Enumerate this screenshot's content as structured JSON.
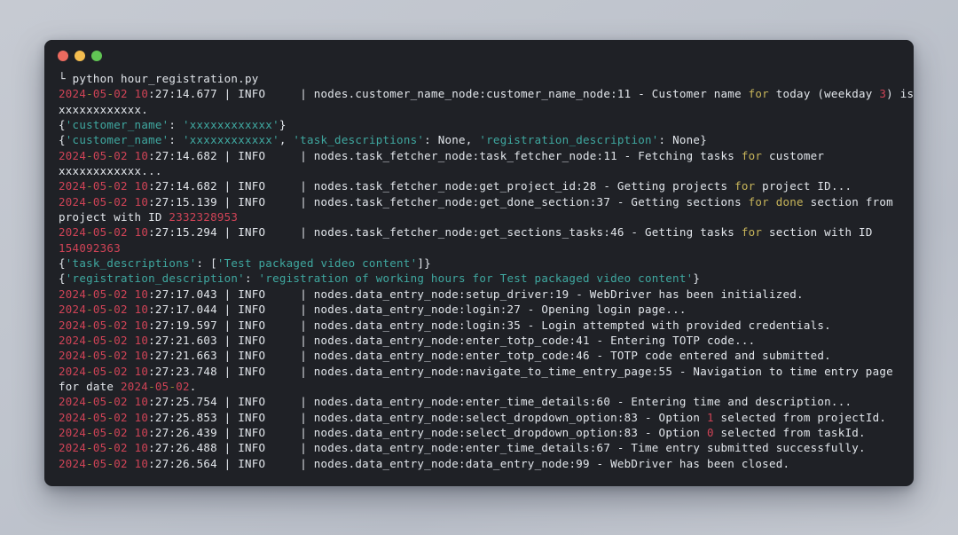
{
  "window": {
    "title": "Terminal",
    "buttons": [
      {
        "name": "close",
        "color": "#ec6a5f"
      },
      {
        "name": "minimize",
        "color": "#f4bd4f"
      },
      {
        "name": "maximize",
        "color": "#61c554"
      }
    ],
    "background": "#1f2126",
    "page_background": "#c2c6cf"
  },
  "terminal": {
    "prompt_symbol": "└",
    "command": "python hour_registration.py",
    "lines": [
      {
        "id": "cmd",
        "segments": [
          {
            "t": "└ ",
            "c": "c-white"
          },
          {
            "t": "python hour_registration.py",
            "c": "c-white"
          }
        ]
      },
      {
        "id": "log-1",
        "segments": [
          {
            "t": "2024",
            "c": "c-num"
          },
          {
            "t": "-",
            "c": "c-dash"
          },
          {
            "t": "05",
            "c": "c-num"
          },
          {
            "t": "-",
            "c": "c-dash"
          },
          {
            "t": "02",
            "c": "c-num"
          },
          {
            "t": " ",
            "c": "c-white"
          },
          {
            "t": "10",
            "c": "c-num"
          },
          {
            "t": ":27:14.677 | INFO     | nodes.customer_name_node:customer_name_node:11 - Customer name ",
            "c": "c-white"
          },
          {
            "t": "for",
            "c": "c-kw"
          },
          {
            "t": " today (weekday ",
            "c": "c-white"
          },
          {
            "t": "3",
            "c": "c-num"
          },
          {
            "t": ") is",
            "c": "c-white"
          }
        ]
      },
      {
        "id": "log-1-cont",
        "segments": [
          {
            "t": "xxxxxxxxxxxx.",
            "c": "c-white"
          }
        ]
      },
      {
        "id": "dict-1",
        "segments": [
          {
            "t": "{",
            "c": "c-white"
          },
          {
            "t": "'customer_name'",
            "c": "c-key"
          },
          {
            "t": ": ",
            "c": "c-white"
          },
          {
            "t": "'xxxxxxxxxxxx'",
            "c": "c-str"
          },
          {
            "t": "}",
            "c": "c-white"
          }
        ]
      },
      {
        "id": "dict-2",
        "segments": [
          {
            "t": "{",
            "c": "c-white"
          },
          {
            "t": "'customer_name'",
            "c": "c-key"
          },
          {
            "t": ": ",
            "c": "c-white"
          },
          {
            "t": "'xxxxxxxxxxxx'",
            "c": "c-str"
          },
          {
            "t": ", ",
            "c": "c-white"
          },
          {
            "t": "'task_descriptions'",
            "c": "c-key"
          },
          {
            "t": ": None, ",
            "c": "c-white"
          },
          {
            "t": "'registration_description'",
            "c": "c-key"
          },
          {
            "t": ": None}",
            "c": "c-white"
          }
        ]
      },
      {
        "id": "log-2",
        "segments": [
          {
            "t": "2024",
            "c": "c-num"
          },
          {
            "t": "-",
            "c": "c-dash"
          },
          {
            "t": "05",
            "c": "c-num"
          },
          {
            "t": "-",
            "c": "c-dash"
          },
          {
            "t": "02",
            "c": "c-num"
          },
          {
            "t": " ",
            "c": "c-white"
          },
          {
            "t": "10",
            "c": "c-num"
          },
          {
            "t": ":27:14.682 | INFO     | nodes.task_fetcher_node:task_fetcher_node:11 - Fetching tasks ",
            "c": "c-white"
          },
          {
            "t": "for",
            "c": "c-kw"
          },
          {
            "t": " customer",
            "c": "c-white"
          }
        ]
      },
      {
        "id": "log-2-cont",
        "segments": [
          {
            "t": "xxxxxxxxxxxx...",
            "c": "c-white"
          }
        ]
      },
      {
        "id": "log-3",
        "segments": [
          {
            "t": "2024",
            "c": "c-num"
          },
          {
            "t": "-",
            "c": "c-dash"
          },
          {
            "t": "05",
            "c": "c-num"
          },
          {
            "t": "-",
            "c": "c-dash"
          },
          {
            "t": "02",
            "c": "c-num"
          },
          {
            "t": " ",
            "c": "c-white"
          },
          {
            "t": "10",
            "c": "c-num"
          },
          {
            "t": ":27:14.682 | INFO     | nodes.task_fetcher_node:get_project_id:28 - Getting projects ",
            "c": "c-white"
          },
          {
            "t": "for",
            "c": "c-kw"
          },
          {
            "t": " project ID...",
            "c": "c-white"
          }
        ]
      },
      {
        "id": "log-4",
        "segments": [
          {
            "t": "2024",
            "c": "c-num"
          },
          {
            "t": "-",
            "c": "c-dash"
          },
          {
            "t": "05",
            "c": "c-num"
          },
          {
            "t": "-",
            "c": "c-dash"
          },
          {
            "t": "02",
            "c": "c-num"
          },
          {
            "t": " ",
            "c": "c-white"
          },
          {
            "t": "10",
            "c": "c-num"
          },
          {
            "t": ":27:15.139 | INFO     | nodes.task_fetcher_node:get_done_section:37 - Getting sections ",
            "c": "c-white"
          },
          {
            "t": "for",
            "c": "c-kw"
          },
          {
            "t": " ",
            "c": "c-white"
          },
          {
            "t": "done",
            "c": "c-kw"
          },
          {
            "t": " section from",
            "c": "c-white"
          }
        ]
      },
      {
        "id": "log-4-cont",
        "segments": [
          {
            "t": "project with ID ",
            "c": "c-white"
          },
          {
            "t": "2332328953",
            "c": "c-num"
          }
        ]
      },
      {
        "id": "log-5",
        "segments": [
          {
            "t": "2024",
            "c": "c-num"
          },
          {
            "t": "-",
            "c": "c-dash"
          },
          {
            "t": "05",
            "c": "c-num"
          },
          {
            "t": "-",
            "c": "c-dash"
          },
          {
            "t": "02",
            "c": "c-num"
          },
          {
            "t": " ",
            "c": "c-white"
          },
          {
            "t": "10",
            "c": "c-num"
          },
          {
            "t": ":27:15.294 | INFO     | nodes.task_fetcher_node:get_sections_tasks:46 - Getting tasks ",
            "c": "c-white"
          },
          {
            "t": "for",
            "c": "c-kw"
          },
          {
            "t": " section with ID",
            "c": "c-white"
          }
        ]
      },
      {
        "id": "log-5-cont",
        "segments": [
          {
            "t": "154092363",
            "c": "c-num"
          }
        ]
      },
      {
        "id": "dict-3",
        "segments": [
          {
            "t": "{",
            "c": "c-white"
          },
          {
            "t": "'task_descriptions'",
            "c": "c-key"
          },
          {
            "t": ": [",
            "c": "c-white"
          },
          {
            "t": "'Test packaged video content'",
            "c": "c-str"
          },
          {
            "t": "]}",
            "c": "c-white"
          }
        ]
      },
      {
        "id": "dict-4",
        "segments": [
          {
            "t": "{",
            "c": "c-white"
          },
          {
            "t": "'registration_description'",
            "c": "c-key"
          },
          {
            "t": ": ",
            "c": "c-white"
          },
          {
            "t": "'registration of working hours for Test packaged video content'",
            "c": "c-str"
          },
          {
            "t": "}",
            "c": "c-white"
          }
        ]
      },
      {
        "id": "log-6",
        "segments": [
          {
            "t": "2024",
            "c": "c-num"
          },
          {
            "t": "-",
            "c": "c-dash"
          },
          {
            "t": "05",
            "c": "c-num"
          },
          {
            "t": "-",
            "c": "c-dash"
          },
          {
            "t": "02",
            "c": "c-num"
          },
          {
            "t": " ",
            "c": "c-white"
          },
          {
            "t": "10",
            "c": "c-num"
          },
          {
            "t": ":27:17.043 | INFO     | nodes.data_entry_node:setup_driver:19 - WebDriver has been initialized.",
            "c": "c-white"
          }
        ]
      },
      {
        "id": "log-7",
        "segments": [
          {
            "t": "2024",
            "c": "c-num"
          },
          {
            "t": "-",
            "c": "c-dash"
          },
          {
            "t": "05",
            "c": "c-num"
          },
          {
            "t": "-",
            "c": "c-dash"
          },
          {
            "t": "02",
            "c": "c-num"
          },
          {
            "t": " ",
            "c": "c-white"
          },
          {
            "t": "10",
            "c": "c-num"
          },
          {
            "t": ":27:17.044 | INFO     | nodes.data_entry_node:login:27 - Opening login page...",
            "c": "c-white"
          }
        ]
      },
      {
        "id": "log-8",
        "segments": [
          {
            "t": "2024",
            "c": "c-num"
          },
          {
            "t": "-",
            "c": "c-dash"
          },
          {
            "t": "05",
            "c": "c-num"
          },
          {
            "t": "-",
            "c": "c-dash"
          },
          {
            "t": "02",
            "c": "c-num"
          },
          {
            "t": " ",
            "c": "c-white"
          },
          {
            "t": "10",
            "c": "c-num"
          },
          {
            "t": ":27:19.597 | INFO     | nodes.data_entry_node:login:35 - Login attempted with provided credentials.",
            "c": "c-white"
          }
        ]
      },
      {
        "id": "log-9",
        "segments": [
          {
            "t": "2024",
            "c": "c-num"
          },
          {
            "t": "-",
            "c": "c-dash"
          },
          {
            "t": "05",
            "c": "c-num"
          },
          {
            "t": "-",
            "c": "c-dash"
          },
          {
            "t": "02",
            "c": "c-num"
          },
          {
            "t": " ",
            "c": "c-white"
          },
          {
            "t": "10",
            "c": "c-num"
          },
          {
            "t": ":27:21.603 | INFO     | nodes.data_entry_node:enter_totp_code:41 - Entering TOTP code...",
            "c": "c-white"
          }
        ]
      },
      {
        "id": "log-10",
        "segments": [
          {
            "t": "2024",
            "c": "c-num"
          },
          {
            "t": "-",
            "c": "c-dash"
          },
          {
            "t": "05",
            "c": "c-num"
          },
          {
            "t": "-",
            "c": "c-dash"
          },
          {
            "t": "02",
            "c": "c-num"
          },
          {
            "t": " ",
            "c": "c-white"
          },
          {
            "t": "10",
            "c": "c-num"
          },
          {
            "t": ":27:21.663 | INFO     | nodes.data_entry_node:enter_totp_code:46 - TOTP code entered and submitted.",
            "c": "c-white"
          }
        ]
      },
      {
        "id": "log-11",
        "segments": [
          {
            "t": "2024",
            "c": "c-num"
          },
          {
            "t": "-",
            "c": "c-dash"
          },
          {
            "t": "05",
            "c": "c-num"
          },
          {
            "t": "-",
            "c": "c-dash"
          },
          {
            "t": "02",
            "c": "c-num"
          },
          {
            "t": " ",
            "c": "c-white"
          },
          {
            "t": "10",
            "c": "c-num"
          },
          {
            "t": ":27:23.748 | INFO     | nodes.data_entry_node:navigate_to_time_entry_page:55 - Navigation to time entry page",
            "c": "c-white"
          }
        ]
      },
      {
        "id": "log-11-cont",
        "segments": [
          {
            "t": "for date ",
            "c": "c-white"
          },
          {
            "t": "2024",
            "c": "c-num"
          },
          {
            "t": "-",
            "c": "c-dash"
          },
          {
            "t": "05",
            "c": "c-num"
          },
          {
            "t": "-",
            "c": "c-dash"
          },
          {
            "t": "02",
            "c": "c-num"
          },
          {
            "t": ".",
            "c": "c-white"
          }
        ]
      },
      {
        "id": "log-12",
        "segments": [
          {
            "t": "2024",
            "c": "c-num"
          },
          {
            "t": "-",
            "c": "c-dash"
          },
          {
            "t": "05",
            "c": "c-num"
          },
          {
            "t": "-",
            "c": "c-dash"
          },
          {
            "t": "02",
            "c": "c-num"
          },
          {
            "t": " ",
            "c": "c-white"
          },
          {
            "t": "10",
            "c": "c-num"
          },
          {
            "t": ":27:25.754 | INFO     | nodes.data_entry_node:enter_time_details:60 - Entering time and description...",
            "c": "c-white"
          }
        ]
      },
      {
        "id": "log-13",
        "segments": [
          {
            "t": "2024",
            "c": "c-num"
          },
          {
            "t": "-",
            "c": "c-dash"
          },
          {
            "t": "05",
            "c": "c-num"
          },
          {
            "t": "-",
            "c": "c-dash"
          },
          {
            "t": "02",
            "c": "c-num"
          },
          {
            "t": " ",
            "c": "c-white"
          },
          {
            "t": "10",
            "c": "c-num"
          },
          {
            "t": ":27:25.853 | INFO     | nodes.data_entry_node:select_dropdown_option:83 - Option ",
            "c": "c-white"
          },
          {
            "t": "1",
            "c": "c-num"
          },
          {
            "t": " selected from projectId.",
            "c": "c-white"
          }
        ]
      },
      {
        "id": "log-14",
        "segments": [
          {
            "t": "2024",
            "c": "c-num"
          },
          {
            "t": "-",
            "c": "c-dash"
          },
          {
            "t": "05",
            "c": "c-num"
          },
          {
            "t": "-",
            "c": "c-dash"
          },
          {
            "t": "02",
            "c": "c-num"
          },
          {
            "t": " ",
            "c": "c-white"
          },
          {
            "t": "10",
            "c": "c-num"
          },
          {
            "t": ":27:26.439 | INFO     | nodes.data_entry_node:select_dropdown_option:83 - Option ",
            "c": "c-white"
          },
          {
            "t": "0",
            "c": "c-num"
          },
          {
            "t": " selected from taskId.",
            "c": "c-white"
          }
        ]
      },
      {
        "id": "log-15",
        "segments": [
          {
            "t": "2024",
            "c": "c-num"
          },
          {
            "t": "-",
            "c": "c-dash"
          },
          {
            "t": "05",
            "c": "c-num"
          },
          {
            "t": "-",
            "c": "c-dash"
          },
          {
            "t": "02",
            "c": "c-num"
          },
          {
            "t": " ",
            "c": "c-white"
          },
          {
            "t": "10",
            "c": "c-num"
          },
          {
            "t": ":27:26.488 | INFO     | nodes.data_entry_node:enter_time_details:67 - Time entry submitted successfully.",
            "c": "c-white"
          }
        ]
      },
      {
        "id": "log-16",
        "segments": [
          {
            "t": "2024",
            "c": "c-num"
          },
          {
            "t": "-",
            "c": "c-dash"
          },
          {
            "t": "05",
            "c": "c-num"
          },
          {
            "t": "-",
            "c": "c-dash"
          },
          {
            "t": "02",
            "c": "c-num"
          },
          {
            "t": " ",
            "c": "c-white"
          },
          {
            "t": "10",
            "c": "c-num"
          },
          {
            "t": ":27:26.564 | INFO     | nodes.data_entry_node:data_entry_node:99 - WebDriver has been closed.",
            "c": "c-white"
          }
        ]
      }
    ]
  }
}
